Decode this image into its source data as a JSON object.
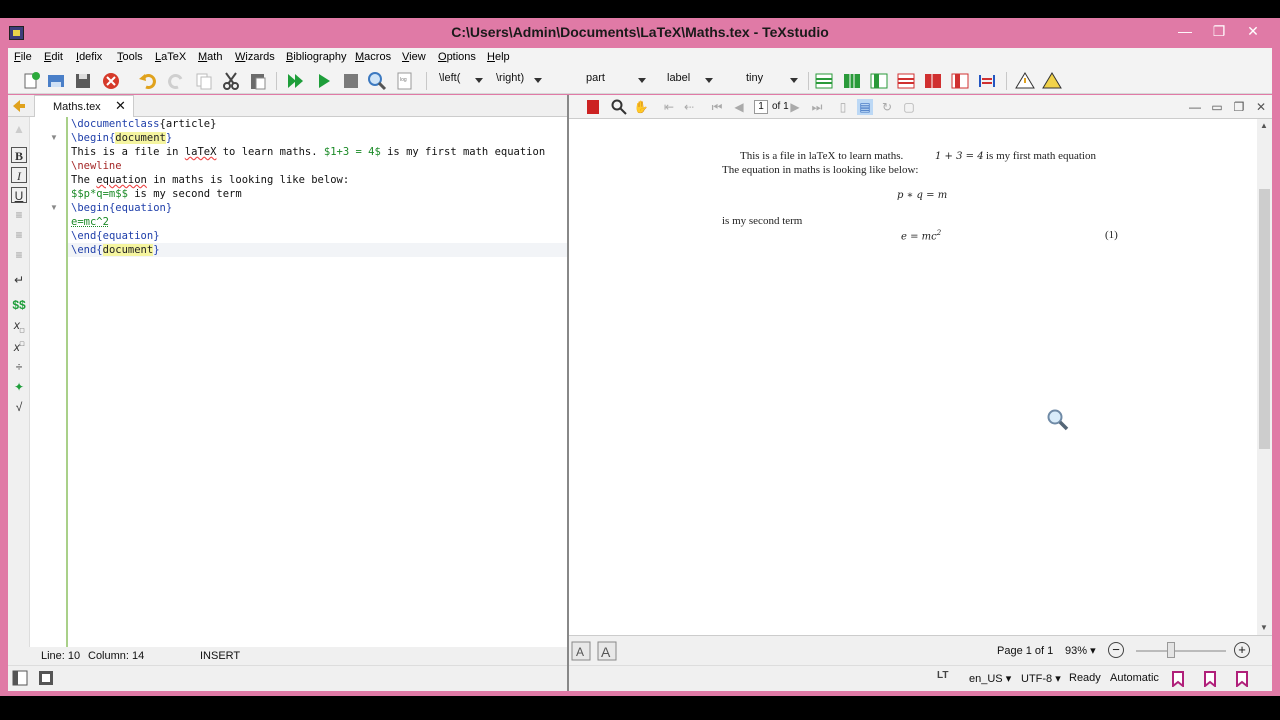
{
  "window": {
    "title": "C:\\Users\\Admin\\Documents\\LaTeX\\Maths.tex - TeXstudio"
  },
  "menu": [
    "File",
    "Edit",
    "Idefix",
    "Tools",
    "LaTeX",
    "Math",
    "Wizards",
    "Bibliography",
    "Macros",
    "View",
    "Options",
    "Help"
  ],
  "toolbar": {
    "left_combo": "\\left(",
    "right_combo": "\\right)",
    "section_combo": "part",
    "label_combo": "label",
    "size_combo": "tiny"
  },
  "tab": {
    "label": "Maths.tex",
    "close": "✕"
  },
  "editor": {
    "line1": {
      "cmd": "\\documentclass",
      "arg": "{article}"
    },
    "line2": {
      "cmd": "\\begin",
      "open": "{",
      "arg": "document",
      "close": "}"
    },
    "line3": {
      "pre": "This is a file in ",
      "err": "laTeX",
      "mid": " to learn maths. ",
      "math": "$1+3 = 4$",
      "post": " is my first math equation"
    },
    "line4": "\\newline",
    "line5": {
      "pre": "The ",
      "err": "equation",
      "post": " in maths is looking like below:"
    },
    "line6": {
      "math": "$$p*q=m$$",
      "post": " is my second term"
    },
    "line7": {
      "cmd": "\\begin",
      "open": "{",
      "arg": "equation",
      "close": "}"
    },
    "line8": "e=mc^2",
    "line9": {
      "cmd": "\\end",
      "open": "{",
      "arg": "equation",
      "close": "}"
    },
    "line10": {
      "cmd": "\\end",
      "open": "{",
      "arg": "document",
      "close": "}"
    }
  },
  "status": {
    "line": "Line: 10",
    "column": "Column: 14",
    "mode": "INSERT"
  },
  "pdf": {
    "page_num": "1",
    "page_of": "of 1",
    "p1": "This is a file in laTeX to learn maths.",
    "p1_math": "1 + 3 = 4",
    "p1_post": "is my first math equation",
    "p2": "The equation in maths is looking like below:",
    "eq1": "p ∗ q = m",
    "p3": "is my second term",
    "eq2": "e = mc",
    "eq2_sup": "2",
    "eq2_num": "(1)",
    "page_label": "Page 1 of 1",
    "zoom": "93%"
  },
  "bottom": {
    "language": "en_US",
    "encoding": "UTF-8",
    "ready": "Ready",
    "automatic": "Automatic",
    "lt": "LT"
  },
  "colors": {
    "titlebar": "#e07aa6",
    "editor_accent": "#a9d089",
    "run_green": "#1e9e3a"
  }
}
